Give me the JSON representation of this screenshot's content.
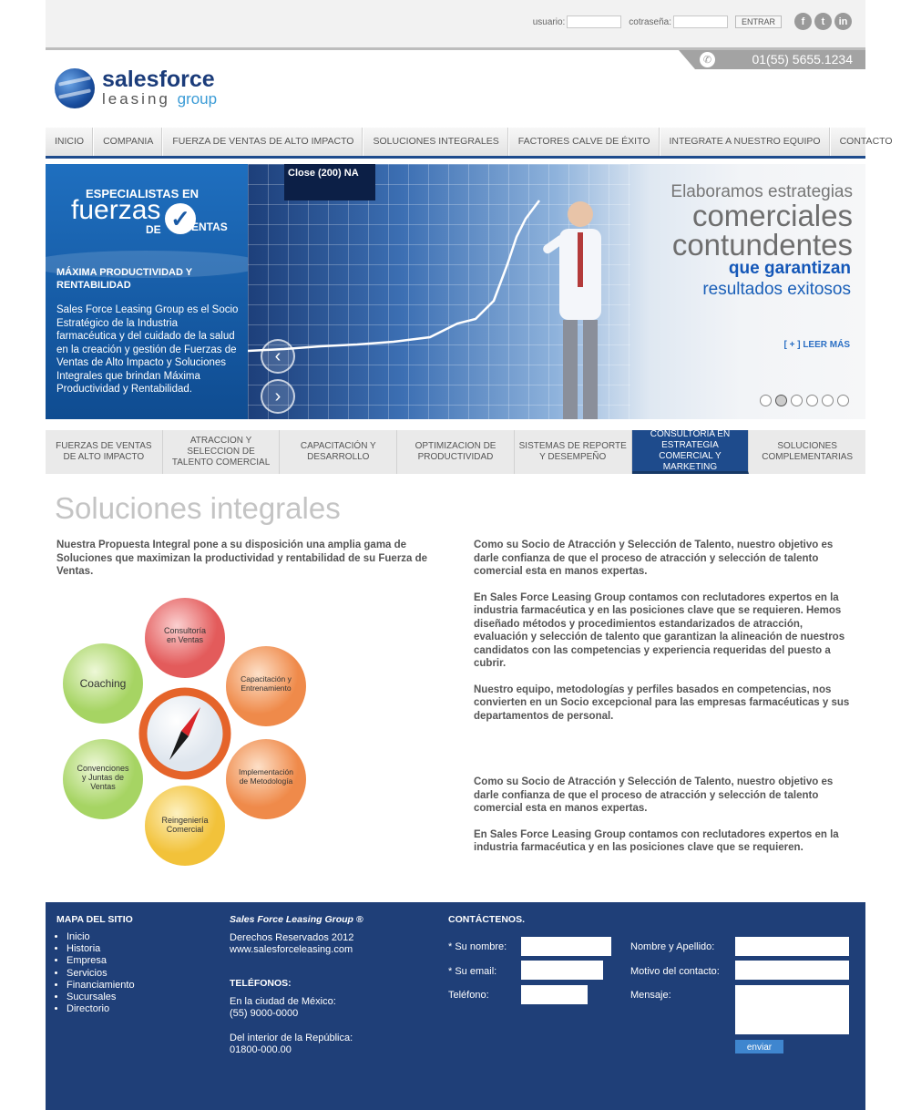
{
  "login": {
    "user_label": "usuario:",
    "pass_label": "cotraseña:",
    "submit": "ENTRAR"
  },
  "social": [
    "f",
    "t",
    "in"
  ],
  "phone": "01(55) 5655.1234",
  "logo": {
    "line1a": "sales",
    "line1b": "force",
    "line2a": "leasing ",
    "line2b": "group"
  },
  "nav": [
    "INICIO",
    "COMPANIA",
    "FUERZA DE VENTAS DE ALTO IMPACTO",
    "SOLUCIONES INTEGRALES",
    "FACTORES CALVE DE ÉXITO",
    "INTEGRATE A NUESTRO EQUIPO",
    "CONTACTO"
  ],
  "hero": {
    "badge_top": "ESPECIALISTAS EN",
    "badge_main": "fuerzas",
    "badge_de": "DE",
    "badge_ventas": "ENTAS",
    "heading": "MÁXIMA PRODUCTIVIDAD Y RENTABILIDAD",
    "body": "Sales Force Leasing Group es el Socio Estratégico de la Industria farmacéutica y del cuidado de la salud en la creación y gestión de Fuerzas de Ventas de Alto Impacto y Soluciones Integrales que brindan Máxima Productividad y Rentabilidad.",
    "screen_label": "Close (200)  NA",
    "line1": "Elaboramos estrategias",
    "line2": "comerciales",
    "line3": "contundentes",
    "line4": "que garantizan",
    "line5": "resultados exitosos",
    "read_more": "[ + ] LEER MÁS",
    "slides": 6,
    "active_slide": 2
  },
  "services": [
    {
      "label": "FUERZAS DE VENTAS DE ALTO IMPACTO",
      "active": false
    },
    {
      "label": "ATRACCION Y SELECCION DE TALENTO COMERCIAL",
      "active": false
    },
    {
      "label": "CAPACITACIÓN Y DESARROLLO",
      "active": false
    },
    {
      "label": "OPTIMIZACION DE PRODUCTIVIDAD",
      "active": false
    },
    {
      "label": "SISTEMAS DE REPORTE Y DESEMPEÑO",
      "active": false
    },
    {
      "label": "CONSULTORIA EN ESTRATEGIA COMERCIAL Y MARKETING",
      "active": true
    },
    {
      "label": "SOLUCIONES COMPLEMENTARIAS",
      "active": false
    }
  ],
  "content": {
    "title": "Soluciones integrales",
    "intro": "Nuestra Propuesta Integral pone a su disposición una amplia gama de Soluciones que maximizan la productividad y rentabilidad de su Fuerza de Ventas.",
    "wheel": [
      "Consultoría en Ventas",
      "Capacitación y Entrenamiento",
      "Implementación de Metodología",
      "Reingeniería Comercial",
      "Convenciones y Juntas de Ventas",
      "Coaching"
    ],
    "col2": [
      "Como su Socio de Atracción y Selección de Talento, nuestro objetivo es darle confianza de que el proceso de atracción y selección de talento comercial esta en manos expertas.",
      "En Sales Force Leasing Group contamos con reclutadores expertos en la industria farmacéutica y en las posiciones clave que se requieren. Hemos diseñado métodos y procedimientos estandarizados de atracción, evaluación y  selección de talento que garantizan la alineación de nuestros candidatos con las competencias y experiencia requeridas del puesto a cubrir.",
      "Nuestro equipo, metodologías y perfiles basados en competencias, nos convierten en un Socio excepcional para las empresas farmacéuticas y sus departamentos de personal."
    ],
    "col3": [
      "Como su Socio de Atracción y Selección de Talento, nuestro objetivo es darle confianza de que el proceso de atracción y selección de talento comercial esta en manos expertas.",
      "En Sales Force Leasing Group contamos con reclutadores expertos en la industria farmacéutica y en las posiciones clave que se requieren."
    ]
  },
  "footer": {
    "sitemap_title": "MAPA DEL SITIO",
    "sitemap": [
      "Inicio",
      "Historia",
      "Empresa",
      "Servicios",
      "Financiamiento",
      "Sucursales",
      "Directorio"
    ],
    "company": "Sales Force Leasing Group ®",
    "rights": "Derechos Reservados 2012",
    "website": "www.salesforceleasing.com",
    "phones_title": "TELÉFONOS:",
    "city_label": "En la ciudad de México:",
    "city_phone": "(55) 9000-0000",
    "interior_label": "Del interior de la República:",
    "interior_phone": "01800-000.00",
    "contact_title": "CONTÁCTENOS.",
    "name_label": "* Su nombre:",
    "email_label": "* Su email:",
    "phone_label": "Teléfono:",
    "fullname_label": "Nombre y Apellido:",
    "reason_label": "Motivo del contacto:",
    "message_label": "Mensaje:",
    "send": "enviar"
  },
  "colors": {
    "brand_blue": "#1e4b8c",
    "footer_bg": "#1f3f78",
    "accent": "#3a9bd6"
  }
}
